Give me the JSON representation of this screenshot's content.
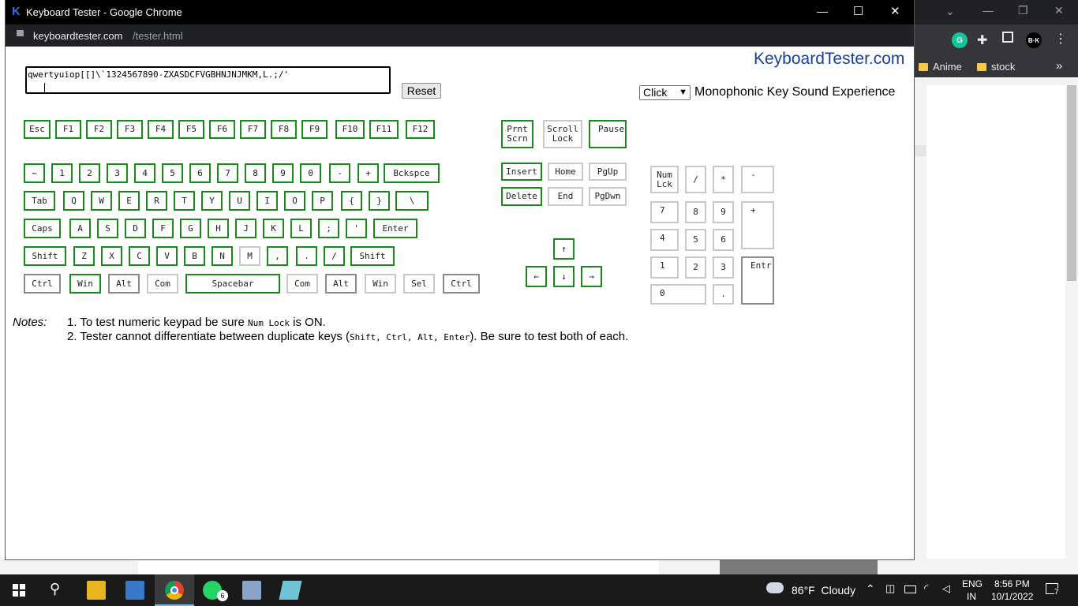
{
  "background_window": {
    "bookmarks": [
      {
        "label": "Anime"
      },
      {
        "label": "stock"
      }
    ],
    "more": "»",
    "profile": "B·K",
    "grammarly": "G"
  },
  "popup": {
    "title": "Keyboard Tester - Google Chrome",
    "logo": "K",
    "url_domain": "keyboardtester.com",
    "url_path": "/tester.html",
    "controls": {
      "minimize": "—",
      "maximize": "☐",
      "close": "✕"
    }
  },
  "page": {
    "brand": "KeyboardTester.com",
    "textarea_value": "qwertyuiop[[]\\`1324567890-ZXASDCFVGBHNJNJMKM,L.;/'",
    "reset_label": "Reset",
    "sound_select": {
      "selected": "Click"
    },
    "sound_label": "Monophonic Key Sound Experience",
    "notes_label": "Notes:",
    "note1": {
      "prefix": "1. To test numeric keypad be sure ",
      "code": "Num Lock",
      "suffix": " is ON."
    },
    "note2": {
      "prefix": "2. Tester cannot differentiate between duplicate keys (",
      "code": "Shift, Ctrl, Alt, Enter",
      "suffix": "). Be sure to test both of each."
    }
  },
  "keys": {
    "fn_row": [
      "Esc",
      "F1",
      "F2",
      "F3",
      "F4",
      "F5",
      "F6",
      "F7",
      "F8",
      "F9",
      "F10",
      "F11",
      "F12"
    ],
    "num_row": [
      "~",
      "1",
      "2",
      "3",
      "4",
      "5",
      "6",
      "7",
      "8",
      "9",
      "0",
      "-",
      "+",
      "Bckspce"
    ],
    "q_row": [
      "Tab",
      "Q",
      "W",
      "E",
      "R",
      "T",
      "Y",
      "U",
      "I",
      "O",
      "P",
      "{",
      "}",
      "\\"
    ],
    "a_row": [
      "Caps",
      "A",
      "S",
      "D",
      "F",
      "G",
      "H",
      "J",
      "K",
      "L",
      ";",
      "'",
      "Enter"
    ],
    "z_row": [
      "Shift",
      "Z",
      "X",
      "C",
      "V",
      "B",
      "N",
      "M",
      ",",
      ".",
      "/",
      "Shift"
    ],
    "bottom_row": [
      "Ctrl",
      "Win",
      "Alt",
      "Com",
      "Spacebar",
      "Com",
      "Alt",
      "Win",
      "Sel",
      "Ctrl"
    ],
    "sys": [
      "Prnt Scrn",
      "Scroll Lock",
      "Pause"
    ],
    "nav": [
      "Insert",
      "Home",
      "PgUp",
      "Delete",
      "End",
      "PgDwn"
    ],
    "arrows": [
      "↑",
      "←",
      "↓",
      "→"
    ],
    "numpad": [
      "Num Lck",
      "/",
      "*",
      "-",
      "7",
      "8",
      "9",
      "+",
      "4",
      "5",
      "6",
      "1",
      "2",
      "3",
      "Entr",
      "0",
      "."
    ]
  },
  "taskbar": {
    "weather": "86°F  Cloudy",
    "lang1": "ENG",
    "lang2": "IN",
    "time": "8:56 PM",
    "date": "10/1/2022",
    "whatsapp_badge": "6",
    "notif_count": "7"
  }
}
